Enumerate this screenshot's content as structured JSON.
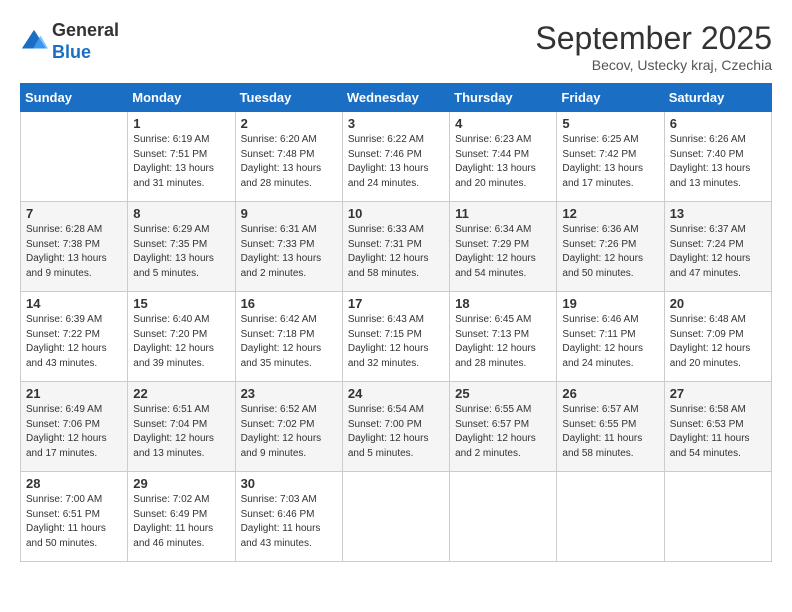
{
  "header": {
    "logo": {
      "general": "General",
      "blue": "Blue"
    },
    "title": "September 2025",
    "location": "Becov, Ustecky kraj, Czechia"
  },
  "calendar": {
    "weekdays": [
      "Sunday",
      "Monday",
      "Tuesday",
      "Wednesday",
      "Thursday",
      "Friday",
      "Saturday"
    ],
    "weeks": [
      [
        {
          "day": "",
          "sunrise": "",
          "sunset": "",
          "daylight": ""
        },
        {
          "day": "1",
          "sunrise": "Sunrise: 6:19 AM",
          "sunset": "Sunset: 7:51 PM",
          "daylight": "Daylight: 13 hours and 31 minutes."
        },
        {
          "day": "2",
          "sunrise": "Sunrise: 6:20 AM",
          "sunset": "Sunset: 7:48 PM",
          "daylight": "Daylight: 13 hours and 28 minutes."
        },
        {
          "day": "3",
          "sunrise": "Sunrise: 6:22 AM",
          "sunset": "Sunset: 7:46 PM",
          "daylight": "Daylight: 13 hours and 24 minutes."
        },
        {
          "day": "4",
          "sunrise": "Sunrise: 6:23 AM",
          "sunset": "Sunset: 7:44 PM",
          "daylight": "Daylight: 13 hours and 20 minutes."
        },
        {
          "day": "5",
          "sunrise": "Sunrise: 6:25 AM",
          "sunset": "Sunset: 7:42 PM",
          "daylight": "Daylight: 13 hours and 17 minutes."
        },
        {
          "day": "6",
          "sunrise": "Sunrise: 6:26 AM",
          "sunset": "Sunset: 7:40 PM",
          "daylight": "Daylight: 13 hours and 13 minutes."
        }
      ],
      [
        {
          "day": "7",
          "sunrise": "Sunrise: 6:28 AM",
          "sunset": "Sunset: 7:38 PM",
          "daylight": "Daylight: 13 hours and 9 minutes."
        },
        {
          "day": "8",
          "sunrise": "Sunrise: 6:29 AM",
          "sunset": "Sunset: 7:35 PM",
          "daylight": "Daylight: 13 hours and 5 minutes."
        },
        {
          "day": "9",
          "sunrise": "Sunrise: 6:31 AM",
          "sunset": "Sunset: 7:33 PM",
          "daylight": "Daylight: 13 hours and 2 minutes."
        },
        {
          "day": "10",
          "sunrise": "Sunrise: 6:33 AM",
          "sunset": "Sunset: 7:31 PM",
          "daylight": "Daylight: 12 hours and 58 minutes."
        },
        {
          "day": "11",
          "sunrise": "Sunrise: 6:34 AM",
          "sunset": "Sunset: 7:29 PM",
          "daylight": "Daylight: 12 hours and 54 minutes."
        },
        {
          "day": "12",
          "sunrise": "Sunrise: 6:36 AM",
          "sunset": "Sunset: 7:26 PM",
          "daylight": "Daylight: 12 hours and 50 minutes."
        },
        {
          "day": "13",
          "sunrise": "Sunrise: 6:37 AM",
          "sunset": "Sunset: 7:24 PM",
          "daylight": "Daylight: 12 hours and 47 minutes."
        }
      ],
      [
        {
          "day": "14",
          "sunrise": "Sunrise: 6:39 AM",
          "sunset": "Sunset: 7:22 PM",
          "daylight": "Daylight: 12 hours and 43 minutes."
        },
        {
          "day": "15",
          "sunrise": "Sunrise: 6:40 AM",
          "sunset": "Sunset: 7:20 PM",
          "daylight": "Daylight: 12 hours and 39 minutes."
        },
        {
          "day": "16",
          "sunrise": "Sunrise: 6:42 AM",
          "sunset": "Sunset: 7:18 PM",
          "daylight": "Daylight: 12 hours and 35 minutes."
        },
        {
          "day": "17",
          "sunrise": "Sunrise: 6:43 AM",
          "sunset": "Sunset: 7:15 PM",
          "daylight": "Daylight: 12 hours and 32 minutes."
        },
        {
          "day": "18",
          "sunrise": "Sunrise: 6:45 AM",
          "sunset": "Sunset: 7:13 PM",
          "daylight": "Daylight: 12 hours and 28 minutes."
        },
        {
          "day": "19",
          "sunrise": "Sunrise: 6:46 AM",
          "sunset": "Sunset: 7:11 PM",
          "daylight": "Daylight: 12 hours and 24 minutes."
        },
        {
          "day": "20",
          "sunrise": "Sunrise: 6:48 AM",
          "sunset": "Sunset: 7:09 PM",
          "daylight": "Daylight: 12 hours and 20 minutes."
        }
      ],
      [
        {
          "day": "21",
          "sunrise": "Sunrise: 6:49 AM",
          "sunset": "Sunset: 7:06 PM",
          "daylight": "Daylight: 12 hours and 17 minutes."
        },
        {
          "day": "22",
          "sunrise": "Sunrise: 6:51 AM",
          "sunset": "Sunset: 7:04 PM",
          "daylight": "Daylight: 12 hours and 13 minutes."
        },
        {
          "day": "23",
          "sunrise": "Sunrise: 6:52 AM",
          "sunset": "Sunset: 7:02 PM",
          "daylight": "Daylight: 12 hours and 9 minutes."
        },
        {
          "day": "24",
          "sunrise": "Sunrise: 6:54 AM",
          "sunset": "Sunset: 7:00 PM",
          "daylight": "Daylight: 12 hours and 5 minutes."
        },
        {
          "day": "25",
          "sunrise": "Sunrise: 6:55 AM",
          "sunset": "Sunset: 6:57 PM",
          "daylight": "Daylight: 12 hours and 2 minutes."
        },
        {
          "day": "26",
          "sunrise": "Sunrise: 6:57 AM",
          "sunset": "Sunset: 6:55 PM",
          "daylight": "Daylight: 11 hours and 58 minutes."
        },
        {
          "day": "27",
          "sunrise": "Sunrise: 6:58 AM",
          "sunset": "Sunset: 6:53 PM",
          "daylight": "Daylight: 11 hours and 54 minutes."
        }
      ],
      [
        {
          "day": "28",
          "sunrise": "Sunrise: 7:00 AM",
          "sunset": "Sunset: 6:51 PM",
          "daylight": "Daylight: 11 hours and 50 minutes."
        },
        {
          "day": "29",
          "sunrise": "Sunrise: 7:02 AM",
          "sunset": "Sunset: 6:49 PM",
          "daylight": "Daylight: 11 hours and 46 minutes."
        },
        {
          "day": "30",
          "sunrise": "Sunrise: 7:03 AM",
          "sunset": "Sunset: 6:46 PM",
          "daylight": "Daylight: 11 hours and 43 minutes."
        },
        {
          "day": "",
          "sunrise": "",
          "sunset": "",
          "daylight": ""
        },
        {
          "day": "",
          "sunrise": "",
          "sunset": "",
          "daylight": ""
        },
        {
          "day": "",
          "sunrise": "",
          "sunset": "",
          "daylight": ""
        },
        {
          "day": "",
          "sunrise": "",
          "sunset": "",
          "daylight": ""
        }
      ]
    ]
  }
}
